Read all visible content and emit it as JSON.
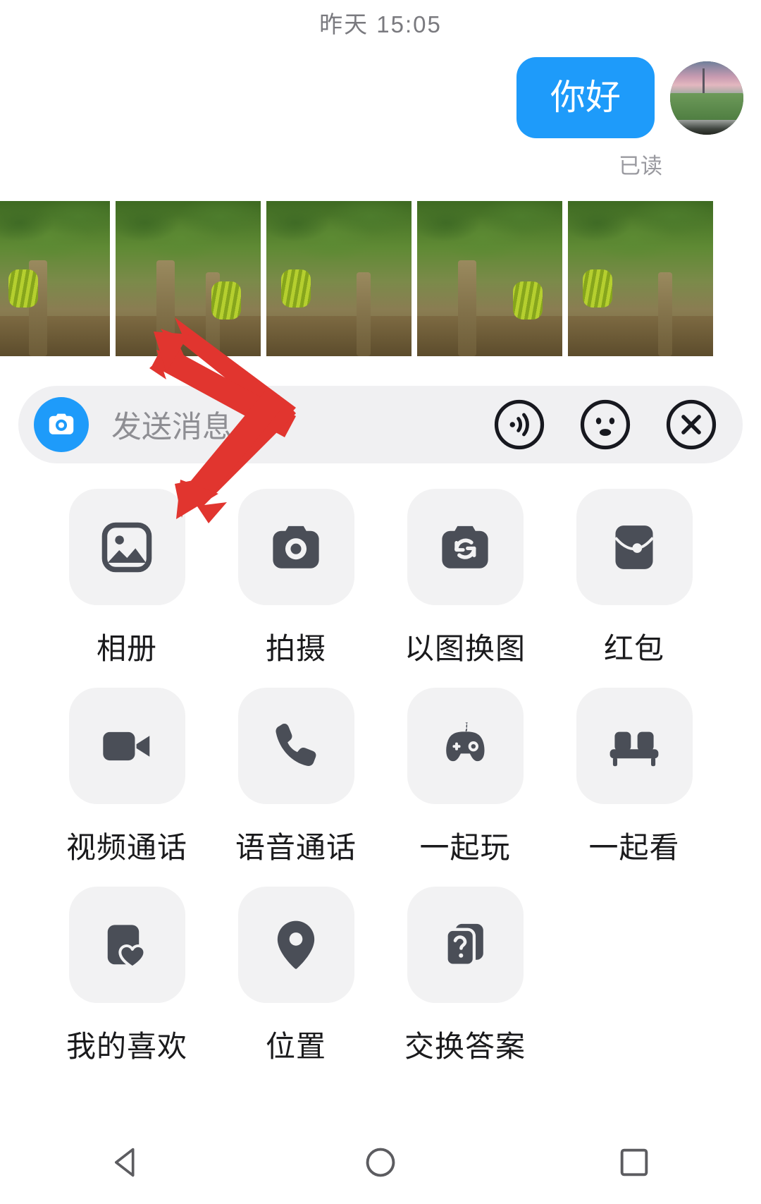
{
  "conversation": {
    "timestamp": "昨天 15:05",
    "outgoing_message": "你好",
    "read_status": "已读",
    "avatar_name": "user-avatar-sunset-road"
  },
  "photo_strip": {
    "name": "banana-plantation-photos",
    "count": 5,
    "photos": [
      {
        "alt": "banana-plantation-1"
      },
      {
        "alt": "banana-plantation-2"
      },
      {
        "alt": "banana-plantation-3"
      },
      {
        "alt": "banana-plantation-4"
      },
      {
        "alt": "banana-plantation-5"
      }
    ]
  },
  "input_bar": {
    "camera_icon": "camera-icon",
    "placeholder": "发送消息",
    "icons": [
      {
        "name": "voice-wave-icon",
        "label": "语音"
      },
      {
        "name": "emoji-face-icon",
        "label": "表情"
      },
      {
        "name": "close-icon",
        "label": "关闭"
      }
    ]
  },
  "app_grid": {
    "rows": [
      [
        {
          "icon": "gallery-icon",
          "label": "相册"
        },
        {
          "icon": "camera-icon",
          "label": "拍摄"
        },
        {
          "icon": "image-swap-icon",
          "label": "以图换图"
        },
        {
          "icon": "red-packet-icon",
          "label": "红包"
        }
      ],
      [
        {
          "icon": "video-call-icon",
          "label": "视频通话"
        },
        {
          "icon": "phone-call-icon",
          "label": "语音通话"
        },
        {
          "icon": "gamepad-icon",
          "label": "一起玩"
        },
        {
          "icon": "sofa-icon",
          "label": "一起看"
        }
      ],
      [
        {
          "icon": "favorite-heart-icon",
          "label": "我的喜欢"
        },
        {
          "icon": "location-pin-icon",
          "label": "位置"
        },
        {
          "icon": "question-cards-icon",
          "label": "交换答案"
        }
      ]
    ]
  },
  "annotations": {
    "arrow_color": "#e1352f",
    "arrows": [
      {
        "name": "arrow-to-photo-strip"
      },
      {
        "name": "arrow-to-gallery-tile"
      }
    ]
  },
  "navbar": {
    "buttons": [
      {
        "name": "back-button",
        "icon": "triangle-back-icon"
      },
      {
        "name": "home-button",
        "icon": "circle-home-icon"
      },
      {
        "name": "recents-button",
        "icon": "square-recents-icon"
      }
    ]
  },
  "colors": {
    "accent_blue": "#1e9bfa",
    "tile_bg": "#f2f2f3",
    "input_bg": "#f0f0f2",
    "icon_dark": "#4a4e57",
    "text_dark": "#1a1a1c",
    "text_muted": "#8e8e93",
    "arrow_red": "#e1352f"
  }
}
